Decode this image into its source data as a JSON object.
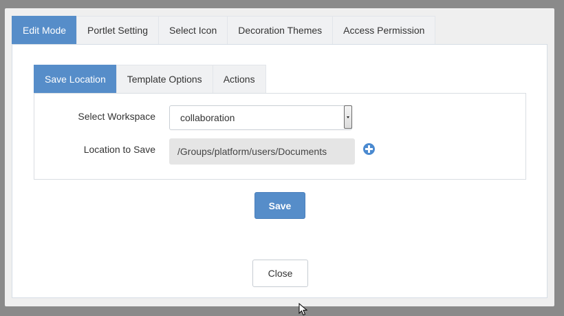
{
  "outer_tabs": [
    {
      "label": "Edit Mode",
      "active": true
    },
    {
      "label": "Portlet Setting",
      "active": false
    },
    {
      "label": "Select Icon",
      "active": false
    },
    {
      "label": "Decoration Themes",
      "active": false
    },
    {
      "label": "Access Permission",
      "active": false
    }
  ],
  "inner_tabs": [
    {
      "label": "Save Location",
      "active": true
    },
    {
      "label": "Template Options",
      "active": false
    },
    {
      "label": "Actions",
      "active": false
    }
  ],
  "form": {
    "workspace_label": "Select Workspace",
    "workspace_value": "collaboration",
    "location_label": "Location to Save",
    "location_value": "/Groups/platform/users/Documents"
  },
  "buttons": {
    "save": "Save",
    "close": "Close"
  },
  "icons": {
    "add": "plus-circle-icon",
    "dropdown": "chevron-down-icon",
    "cursor": "mouse-pointer-icon"
  },
  "colors": {
    "accent": "#568dc9",
    "add_icon": "#4b8ad0"
  }
}
